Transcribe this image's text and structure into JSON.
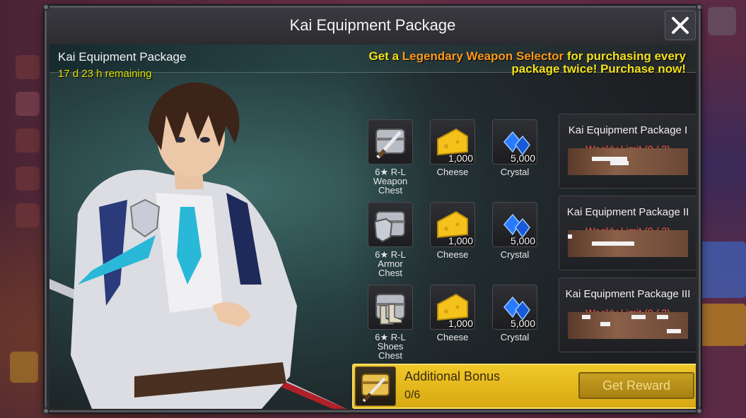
{
  "window": {
    "title": "Kai Equipment Package"
  },
  "header": {
    "package_name": "Kai Equipment Package",
    "remaining": "17 d 23 h remaining",
    "promo_prefix": "Get a ",
    "promo_highlight": "Legendary Weapon Selector",
    "promo_line1_suffix": " for purchasing every",
    "promo_line2": "package twice! Purchase now!"
  },
  "rewards": [
    {
      "chest": {
        "label1": "6★ R-L",
        "label2": "Weapon Chest",
        "icon": "weapon-chest-icon"
      },
      "cheese": {
        "qty": "1,000",
        "label": "Cheese"
      },
      "crystal": {
        "qty": "5,000",
        "label": "Crystal"
      }
    },
    {
      "chest": {
        "label1": "6★ R-L",
        "label2": "Armor Chest",
        "icon": "armor-chest-icon"
      },
      "cheese": {
        "qty": "1,000",
        "label": "Cheese"
      },
      "crystal": {
        "qty": "5,000",
        "label": "Crystal"
      }
    },
    {
      "chest": {
        "label1": "6★ R-L",
        "label2": "Shoes Chest",
        "icon": "shoes-chest-icon"
      },
      "cheese": {
        "qty": "1,000",
        "label": "Cheese"
      },
      "crystal": {
        "qty": "5,000",
        "label": "Crystal"
      }
    }
  ],
  "packages": [
    {
      "title": "Kai Equipment Package I",
      "limit": "Weekly Limit (0 / 2)"
    },
    {
      "title": "Kai Equipment Package II",
      "limit": "Weekly Limit (0 / 2)"
    },
    {
      "title": "Kai Equipment Package III",
      "limit": "Weekly Limit (0 / 2)"
    }
  ],
  "bonus": {
    "title": "Additional Bonus",
    "count": "0/6",
    "button": "Get Reward",
    "icon": "treasure-chest-icon"
  },
  "colors": {
    "accent_yellow": "#f4e21a",
    "highlight_orange": "#ff9a1a",
    "limit_red": "#ff5a3c",
    "bonus_gold": "#f0c828"
  }
}
